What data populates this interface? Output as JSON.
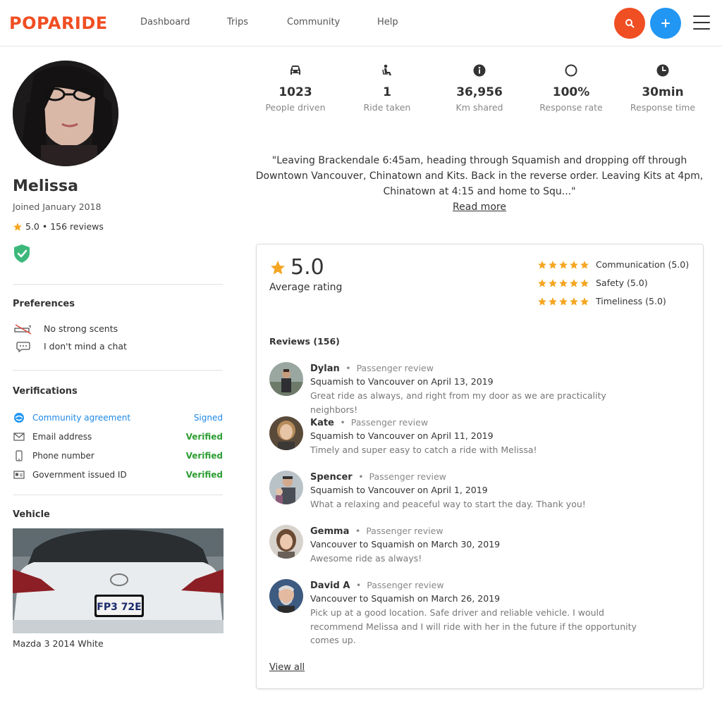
{
  "header": {
    "logo": "POPARIDE",
    "nav": [
      "Dashboard",
      "Trips",
      "Community",
      "Help"
    ],
    "brand_color": "#f04e23",
    "accent_color": "#2196f3",
    "icons": [
      "search-icon",
      "plus-icon",
      "hamburger-menu-icon"
    ]
  },
  "profile": {
    "name": "Melissa",
    "joined": "Joined January 2018",
    "rating_summary": "5.0 • 156 reviews"
  },
  "preferences": {
    "title": "Preferences",
    "items": [
      {
        "icon": "no-scent-icon",
        "label": "No strong scents"
      },
      {
        "icon": "chat-bubble-icon",
        "label": "I don't mind a chat"
      }
    ]
  },
  "verifications": {
    "title": "Verifications",
    "items": [
      {
        "icon": "handshake-icon",
        "label": "Community agreement",
        "status": "Signed"
      },
      {
        "icon": "envelope-icon",
        "label": "Email address",
        "status": "Verified"
      },
      {
        "icon": "phone-icon",
        "label": "Phone number",
        "status": "Verified"
      },
      {
        "icon": "id-card-icon",
        "label": "Government issued ID",
        "status": "Verified"
      }
    ]
  },
  "vehicle": {
    "title": "Vehicle",
    "caption": "Mazda 3 2014 White",
    "plate": "FP3 72E"
  },
  "stats": [
    {
      "icon": "car-icon",
      "value": "1023",
      "label": "People driven"
    },
    {
      "icon": "seat-icon",
      "value": "1",
      "label": "Ride taken"
    },
    {
      "icon": "info-icon",
      "value": "36,956",
      "label": "Km shared"
    },
    {
      "icon": "circle-icon",
      "value": "100%",
      "label": "Response rate"
    },
    {
      "icon": "clock-icon",
      "value": "30min",
      "label": "Response time"
    }
  ],
  "bio": {
    "quote": "\"Leaving Brackendale 6:45am, heading through Squamish and dropping off through Downtown Vancouver, Chinatown and Kits. Back in the reverse order. Leaving Kits at 4pm, Chinatown at 4:15 and home to Squ...\"",
    "read_more": "Read more"
  },
  "ratings": {
    "overall": "5.0",
    "overall_label": "Average rating",
    "star_color": "#f5a623",
    "categories": [
      {
        "label": "Communication (5.0)",
        "stars": 5
      },
      {
        "label": "Safety (5.0)",
        "stars": 5
      },
      {
        "label": "Timeliness (5.0)",
        "stars": 5
      }
    ]
  },
  "reviews": {
    "title": "Reviews (156)",
    "items": [
      {
        "name": "Dylan",
        "type": "Passenger review",
        "route": "Squamish to Vancouver on April 13, 2019",
        "text": "Great ride as always, and right from my door as we are practicality neighbors!"
      },
      {
        "name": "Kate",
        "type": "Passenger review",
        "route": "Squamish to Vancouver on April 11, 2019",
        "text": "Timely and super easy to catch a ride with Melissa!"
      },
      {
        "name": "Spencer",
        "type": "Passenger review",
        "route": "Squamish to Vancouver on April 1, 2019",
        "text": "What a relaxing and peaceful way to start the day. Thank you!"
      },
      {
        "name": "Gemma",
        "type": "Passenger review",
        "route": "Vancouver to Squamish on March 30, 2019",
        "text": "Awesome ride as always!"
      },
      {
        "name": "David A",
        "type": "Passenger review",
        "route": "Vancouver to Squamish on March 26, 2019",
        "text": "Pick up at a good location. Safe driver and reliable vehicle. I would recommend Melissa and I will ride with her in the future if the opportunity comes up."
      }
    ],
    "view_all": "View all"
  }
}
